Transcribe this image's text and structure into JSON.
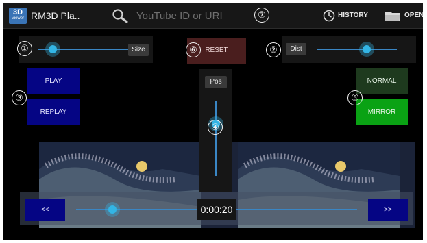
{
  "app": {
    "icon_text_top": "3D",
    "icon_text_bottom": "Viewer",
    "title": "RM3D Pla.."
  },
  "search": {
    "placeholder": "YouTube ID or URI"
  },
  "actions": {
    "history_label": "HISTORY",
    "open_label": "OPEN"
  },
  "markers": [
    "①",
    "②",
    "③",
    "④",
    "⑤",
    "⑥",
    "⑦"
  ],
  "size_control": {
    "label": "Size",
    "value": 0.16
  },
  "dist_control": {
    "label": "Dist",
    "value": 0.62
  },
  "reset_label": "RESET",
  "pos_control": {
    "label": "Pos",
    "value": 0.15
  },
  "play_buttons": {
    "play": "PLAY",
    "replay": "REPLAY"
  },
  "view_mode": {
    "normal": "NORMAL",
    "mirror": "MIRROR",
    "selected": "MIRROR"
  },
  "playback": {
    "rewind_label": "<<",
    "forward_label": ">>",
    "time": "0:00:20",
    "progress": 0.13
  },
  "colors": {
    "accent": "#33b5e5",
    "blue_button": "#050584",
    "normal_button": "#1e3a1e",
    "mirror_button": "#0aa214",
    "reset_button": "#4a1e1e"
  }
}
